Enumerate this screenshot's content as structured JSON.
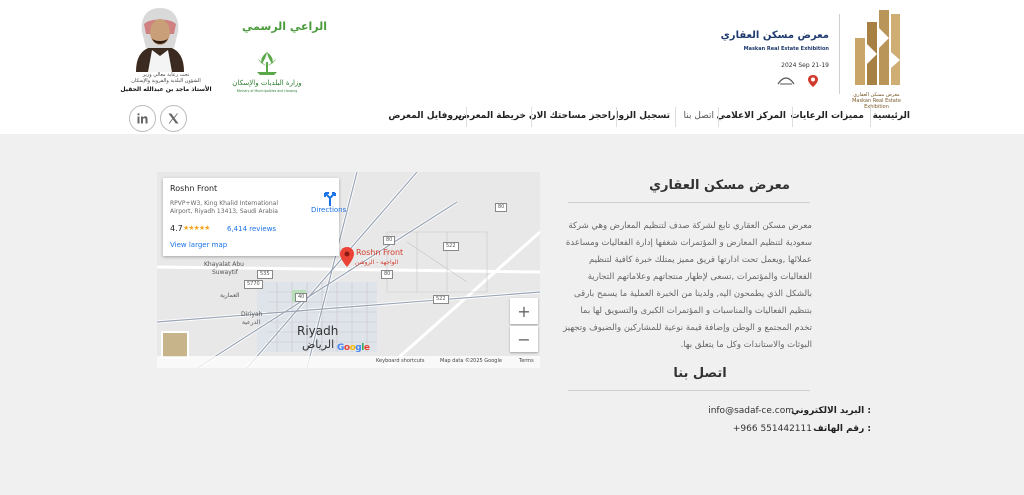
{
  "header": {
    "logo": {
      "icon": "masken-logo-icon",
      "caption": "معرض مسكن العقاري Maskan Real Estate Exhibition",
      "title": "معرض مسكن العقاري",
      "subtitle": "Maskan Real Estate Exhibition",
      "date": "2024 Sep 21-19",
      "venue_icon": "venue-logo-icon",
      "pin_icon": "location-pin-icon"
    },
    "sponsor": {
      "label": "الراعي الرسمي",
      "ministry_logo": "ministry-municipal-housing-logo",
      "ministry_name_ar": "وزارة البلديات والإسكان",
      "ministry_name_en": "Ministry of Municipalities and Housing"
    },
    "person": {
      "caption_line1": "تحت رعاية معالي وزير",
      "caption_line2": "الشؤون البلدية والقروية والإسكان",
      "name": "الأستاذ ماجد بن عبدالله الحقيل"
    },
    "social": [
      {
        "icon": "linkedin-icon"
      },
      {
        "icon": "x-icon"
      }
    ],
    "nav": [
      {
        "label": "الرئيسية"
      },
      {
        "label": "مميزات الرعايات"
      },
      {
        "label": "المركز الاعلامي"
      },
      {
        "label": "اتصل بنا"
      },
      {
        "label": "تسجيل الزوار"
      },
      {
        "label": "احجز مساحتك الان"
      },
      {
        "label": "خريطة المعرض"
      },
      {
        "label": "بروفايل المعرض"
      }
    ]
  },
  "map": {
    "card": {
      "title": "Roshn Front",
      "address": "RPVP+W3, King Khalid International Airport, Riyadh 13413, Saudi Arabia",
      "rating": "4.7",
      "stars": "★★★★★",
      "reviews": "6,414 reviews",
      "larger_map": "View larger map",
      "directions": "Directions",
      "directions_icon": "directions-icon"
    },
    "pin": {
      "label": "Roshn Front",
      "label_ar": "الواجهة - الروشن",
      "icon": "map-pin-icon"
    },
    "labels": {
      "khayalat": "Khayalat Abu",
      "suwaytif": "Suwaytif",
      "ammariyah": "العمارية",
      "diriyah": "Diriyah",
      "diriyah_ar": "الدرعية",
      "riyadh": "Riyadh",
      "riyadh_ar": "الرياض"
    },
    "shields": {
      "s80a": "80",
      "s80b": "80",
      "s80c": "80",
      "s522a": "522",
      "s522b": "522",
      "s535": "535",
      "s5770": "5770",
      "s40": "40"
    },
    "zoom_in": "+",
    "zoom_out": "−",
    "footer": {
      "google": "Google",
      "keyboard": "Keyboard shortcuts",
      "data": "Map data ©2025 Google",
      "terms": "Terms"
    }
  },
  "about": {
    "title": "معرض مسكن العقاري",
    "body": "معرض مسكن العقاري تابع لشركة صدف لتنظيم المعارض وهي شركة سعودية لتنظيم المعارض و المؤتمرات شغفها إدارة الفعاليات ومساعدة عملائها ,ويعمل تحت ادارتها فريق مميز يمتلك خبرة كافية لتنظيم الفعاليات والمؤتمرات ,تسعى لإظهار منتجاتهم وعلاماتهم التجارية بالشكل الذي يطمحون اليه, ولدينا من الخبرة العملية ما يسمح بارقى بتنظيم الفعاليات والمناسبات و المؤتمرات الكبرى والتسويق لها بما تخدم المجتمع و الوطن وإضافة قيمة نوعية للمشاركين والضيوف وتجهيز البوثات والاستاندات وكل ما يتعلق بها."
  },
  "contact": {
    "title": "اتصل بنا",
    "email_label": "البريد الالكتروني :",
    "email": "info@sadaf-ce.com",
    "phone_label": "رقم الهاتف :",
    "phone": "+966 551442111"
  }
}
